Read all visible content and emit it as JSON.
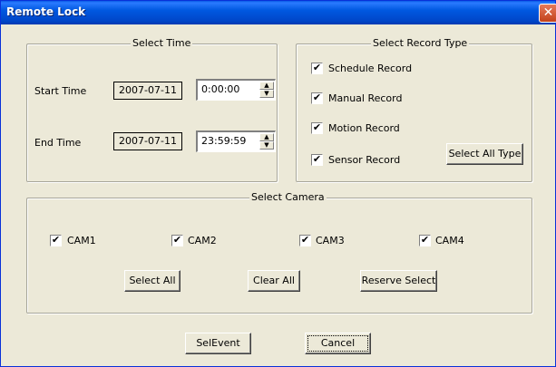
{
  "window": {
    "title": "Remote Lock",
    "close_glyph": "✕"
  },
  "select_time": {
    "legend": "Select Time",
    "start_label": "Start Time",
    "start_date": "2007-07-11",
    "start_time": "0:00:00",
    "end_label": "End Time",
    "end_date": "2007-07-11",
    "end_time": "23:59:59"
  },
  "record_type": {
    "legend": "Select Record Type",
    "items": [
      {
        "label": "Schedule Record",
        "checked": true
      },
      {
        "label": "Manual Record",
        "checked": true
      },
      {
        "label": "Motion Record",
        "checked": true
      },
      {
        "label": "Sensor Record",
        "checked": true
      }
    ],
    "select_all_label": "Select All Type"
  },
  "camera": {
    "legend": "Select Camera",
    "cams": [
      {
        "label": "CAM1",
        "checked": true
      },
      {
        "label": "CAM2",
        "checked": true
      },
      {
        "label": "CAM3",
        "checked": true
      },
      {
        "label": "CAM4",
        "checked": true
      }
    ],
    "select_all_label": "Select All",
    "clear_all_label": "Clear All",
    "reserve_select_label": "Reserve Select"
  },
  "footer": {
    "selevent_label": "SelEvent",
    "cancel_label": "Cancel"
  },
  "check_glyph": "✔",
  "spin_up_glyph": "▲",
  "spin_down_glyph": "▼"
}
